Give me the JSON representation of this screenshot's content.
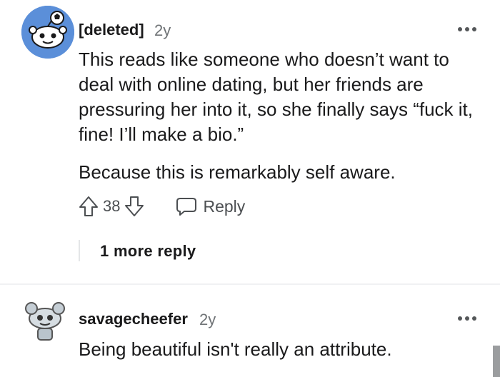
{
  "comments": [
    {
      "author": "[deleted]",
      "age": "2y",
      "body": [
        "This reads like someone who doesn’t want to deal with online dating, but her friends are pressuring her into it, so she finally says “fuck it, fine! I’ll make a bio.”",
        "Because this is remarkably self aware."
      ],
      "votes": "38",
      "reply_label": "Reply",
      "more_replies": "1 more reply",
      "avatar_color": "#5b8fd9"
    },
    {
      "author": "savagecheefer",
      "age": "2y",
      "body": [
        "Being beautiful isn't really an attribute."
      ],
      "avatar_color": "#b9c4cc"
    }
  ],
  "icons": [
    "upvote-icon",
    "downvote-icon",
    "reply-icon",
    "more-options-icon"
  ]
}
